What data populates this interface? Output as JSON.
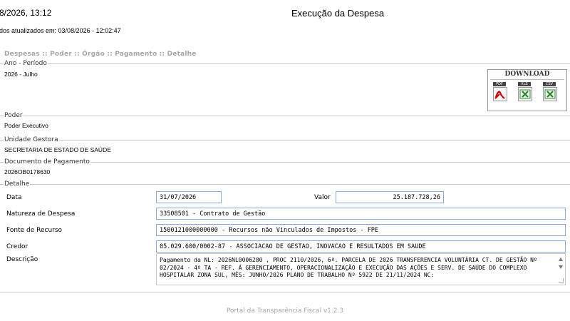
{
  "header": {
    "datetime": "8/2026, 13:12",
    "title": "Execução da Despesa",
    "updated": "dos atualizados em: 03/08/2026 - 12:02:47"
  },
  "breadcrumb": "Despesas :: Poder :: Órgão :: Pagamento :: Detalhe",
  "ano_periodo": {
    "legend": "Ano - Período",
    "value": "2026 - Julho"
  },
  "download": {
    "title": "DOWNLOAD",
    "buttons": [
      {
        "tag": "PDF",
        "icon": "pdf-icon"
      },
      {
        "tag": "XLS",
        "icon": "xls-icon"
      },
      {
        "tag": "CSV",
        "icon": "csv-icon"
      }
    ]
  },
  "poder": {
    "legend": "Poder",
    "value": "Poder Executivo"
  },
  "unidade_gestora": {
    "legend": "Unidade Gestora",
    "value": "SECRETARIA DE ESTADO DE SAÚDE"
  },
  "documento": {
    "legend": "Documento de Pagamento",
    "value": "2026OB0178630"
  },
  "detalhe": {
    "legend": "Detalhe",
    "data_label": "Data",
    "data_value": "31/07/2026",
    "valor_label": "Valor",
    "valor_value": "25.187.728,26",
    "natureza_label": "Natureza de Despesa",
    "natureza_value": "33508501 - Contrato de Gestão",
    "fonte_label": "Fonte de Recurso",
    "fonte_value": "1500121000000000 - Recursos não Vinculados de Impostos - FPE",
    "credor_label": "Credor",
    "credor_value": "05.029.600/0002-87 - ASSOCIACAO DE GESTAO, INOVACAO E RESULTADOS EM SAUDE",
    "descricao_label": "Descrição",
    "descricao_value": "Pagamento da NL: 2026NL0006280 , PROC 2110/2026, 6ª. PARCELA DE 2026 TRANSFERENCIA VOLUNTÁRIA CT. DE GESTÃO Nº 02/2024 - 4º TA - REF. Á GERENCIAMENTO, OPERACIONALIZAÇÃO E EXECUÇÃO DAS AÇÕES E SERV. DE SAÚDE DO COMPLEXO HOSPITALAR ZONA SUL, MÊS: JUNHO/2026 PLANO DE TRABALHO Nº 5922 DE 21/11/2024 NC:"
  },
  "footer": "Portal da Transparência Fiscal v1.2.3"
}
